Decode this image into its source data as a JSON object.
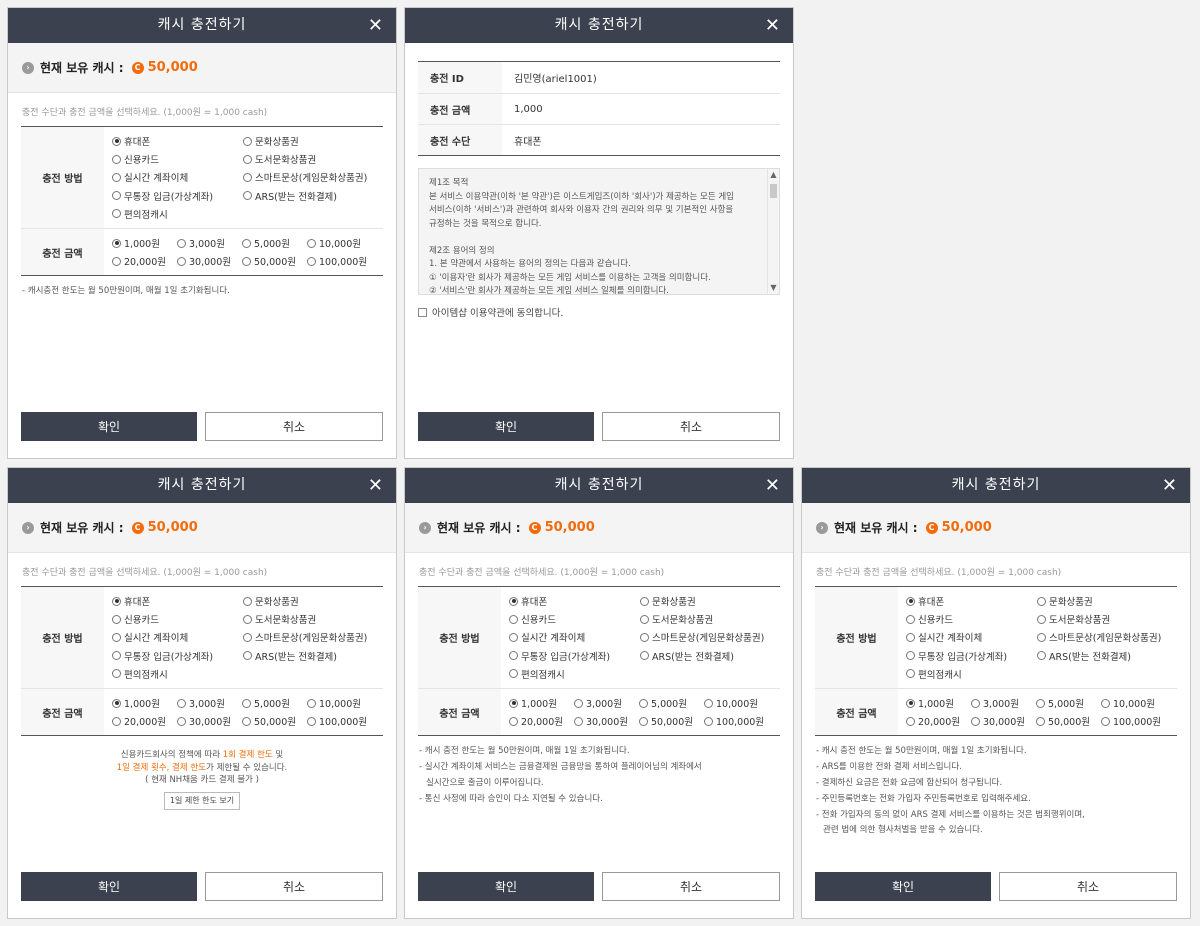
{
  "common": {
    "title": "캐시 충전하기",
    "close": "✕",
    "balance_label": "현재 보유 캐시 :",
    "balance_value": "50,000",
    "coin_symbol": "C",
    "arrow_symbol": "›",
    "hint": "충전 수단과 충전 금액을 선택하세요. (1,000원 = 1,000 cash)",
    "method_label": "충전 방법",
    "amount_label": "충전 금액",
    "confirm": "확인",
    "cancel": "취소",
    "methods": [
      "휴대폰",
      "문화상품권",
      "신용카드",
      "도서문화상품권",
      "실시간 계좌이체",
      "스마트문상(게임문화상품권)",
      "무통장 입금(가상계좌)",
      "ARS(받는 전화결제)",
      "편의점캐시"
    ],
    "amounts": [
      "1,000원",
      "3,000원",
      "5,000원",
      "10,000원",
      "20,000원",
      "30,000원",
      "50,000원",
      "100,000원"
    ]
  },
  "modal1": {
    "notes": [
      "- 캐시충전 한도는 월 50만원이며, 매월 1일 초기화됩니다."
    ]
  },
  "modal2": {
    "rows": [
      {
        "label": "충전 ID",
        "value": "김민영(ariel1001)"
      },
      {
        "label": "충전 금액",
        "value": "1,000"
      },
      {
        "label": "충전 수단",
        "value": "휴대폰"
      }
    ],
    "terms": [
      "제1조 목적",
      "본 서비스 이용약관(이하 '본 약관')은 이스트게임즈(이하 '회사')가 제공하는 모든 게임",
      "서비스(이하 '서비스')과 관련하여 회사와 이용자 간의 권리와 의무 및 기본적인 사항을",
      "규정하는 것을 목적으로 합니다.",
      "",
      "제2조 용어의 정의",
      "1. 본 약관에서 사용하는 용어의 정의는 다음과 같습니다.",
      "① '이용자'란 회사가 제공하는 모든 게임 서비스를 이용하는 고객을 의미합니다.",
      "② '서비스'란 회사가 제공하는 모든 게임 서비스 일체를 의미합니다."
    ],
    "agree": "아이템샵 이용약관에 동의합니다."
  },
  "modal3": {
    "line1_pre": "신용카드회사의 정책에 따라 ",
    "line1_hl": "1회 결제 한도",
    "line1_post": " 및",
    "line2_hl": "1일 결제 횟수, 결제 한도",
    "line2_post": "가 제한될 수 있습니다.",
    "line3": "( 현재 NH채움 카드 결제 불가 )",
    "limit_button": "1일 제한 한도 보기"
  },
  "modal4": {
    "notes": [
      "- 캐시 충전 한도는 월 50만원이며, 매월 1일 초기화됩니다.",
      "- 실시간 계좌이체 서비스는 금융결제원 금융망을 통하여 플레이어님의 계좌에서",
      "  실시간으로 출금이 이루어집니다.",
      "- 통신 사정에 따라 승인이 다소 지연될 수 있습니다."
    ]
  },
  "modal5": {
    "notes": [
      "- 캐시 충전 한도는 월 50만원이며, 매월 1일 초기화됩니다.",
      "- ARS를 이용한 전화 결제 서비스입니다.",
      "- 결제하신 요금은 전화 요금에 합산되어 청구됩니다.",
      "- 주민등록번호는 전화 가입자 주민등록번호로 입력해주세요.",
      "- 전화 가입자의 동의 없이 ARS 결제 서비스를 이용하는 것은 범죄행위이며,",
      "  관련 법에 의한 형사처벌을 받을 수 있습니다."
    ]
  }
}
